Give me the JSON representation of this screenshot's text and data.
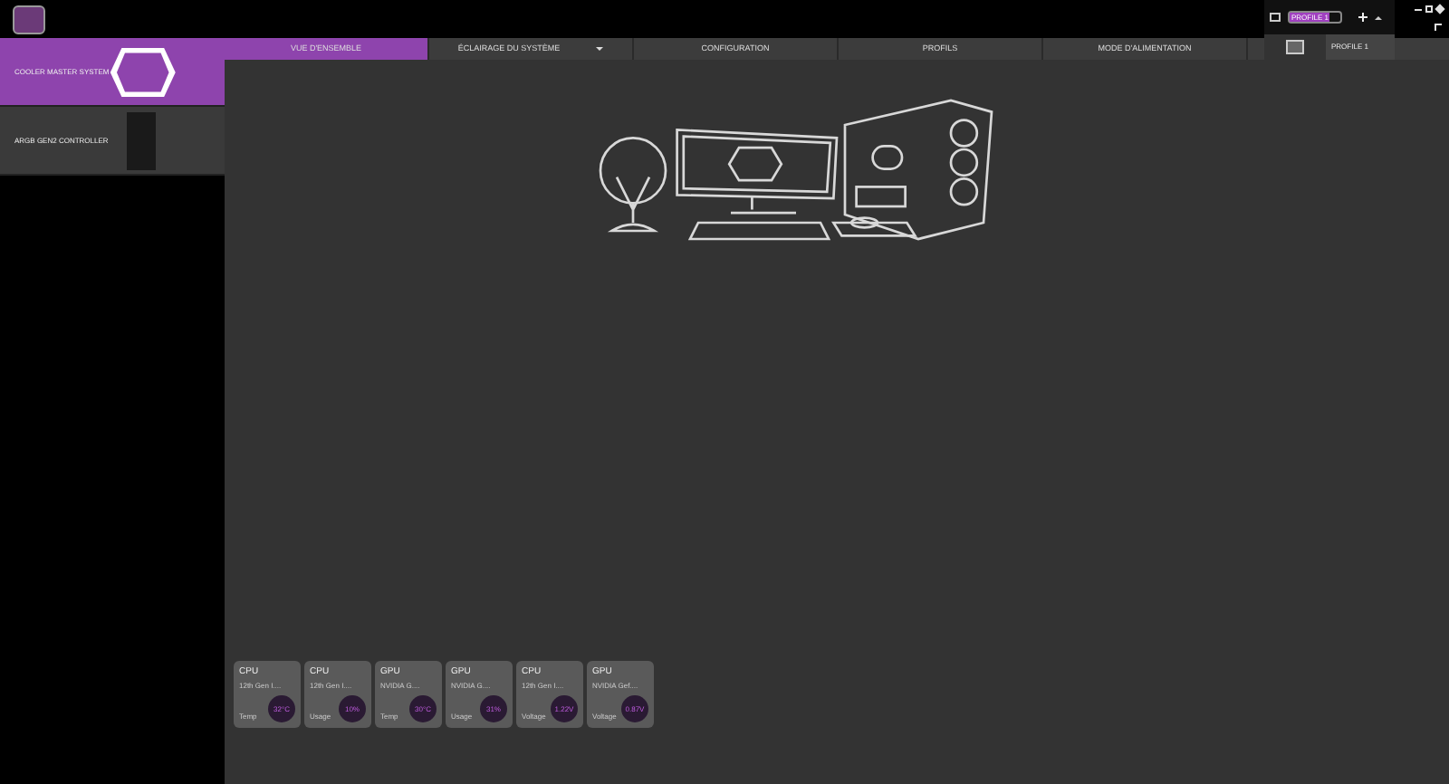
{
  "sidebar": {
    "items": [
      {
        "label": "COOLER MASTER SYSTEM",
        "selected": true,
        "kind": "logo"
      },
      {
        "label": "ARGB GEN2 CONTROLLER",
        "selected": false,
        "kind": "device"
      }
    ]
  },
  "tabs": [
    {
      "label": "VUE D'ENSEMBLE",
      "selected": true,
      "dropdown": false
    },
    {
      "label": "ÉCLAIRAGE DU SYSTÈME",
      "selected": false,
      "dropdown": true
    },
    {
      "label": "CONFIGURATION",
      "selected": false,
      "dropdown": false
    },
    {
      "label": "PROFILS",
      "selected": false,
      "dropdown": false
    },
    {
      "label": "MODE D'ALIMENTATION",
      "selected": false,
      "dropdown": false
    }
  ],
  "profile": {
    "value": "PROFILE 1",
    "menu_items": [
      {
        "label": "PROFILE 1",
        "selected": true
      }
    ]
  },
  "sensors": [
    {
      "device": "CPU",
      "model": "12th Gen I....",
      "metric": "Temp",
      "reading": "32°C"
    },
    {
      "device": "CPU",
      "model": "12th Gen I....",
      "metric": "Usage",
      "reading": "10%"
    },
    {
      "device": "GPU",
      "model": "NVIDIA G....",
      "metric": "Temp",
      "reading": "30°C"
    },
    {
      "device": "GPU",
      "model": "NVIDIA G....",
      "metric": "Usage",
      "reading": "31%"
    },
    {
      "device": "CPU",
      "model": "12th Gen I....",
      "metric": "Voltage",
      "reading": "1.22V"
    },
    {
      "device": "GPU",
      "model": "NVIDIA Gef....",
      "metric": "Voltage",
      "reading": "0.87V"
    }
  ]
}
